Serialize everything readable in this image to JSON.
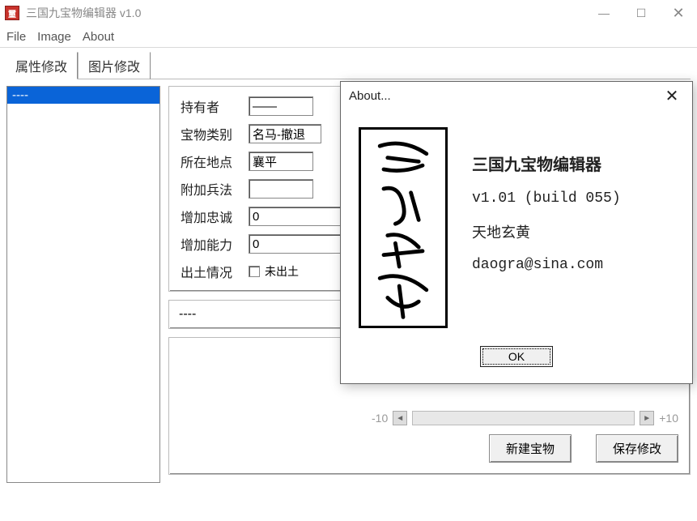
{
  "window": {
    "title": "三国九宝物编辑器 v1.0",
    "icon_char": "璽"
  },
  "menu": {
    "file": "File",
    "image": "Image",
    "about": "About"
  },
  "tabs": {
    "attr": "属性修改",
    "pic": "图片修改"
  },
  "list": {
    "item0": "----"
  },
  "form": {
    "owner_label": "持有者",
    "owner_value": "——",
    "type_label": "宝物类别",
    "type_value": "名马-撤退",
    "loc_label": "所在地点",
    "loc_value": "襄平",
    "tactic_label": "附加兵法",
    "tactic_value": "",
    "loyalty_label": "增加忠诚",
    "loyalty_value": "0",
    "ability_label": "增加能力",
    "ability_value": "0",
    "dig_label": "出土情况",
    "dig_check_label": "未出土"
  },
  "name_display": "----",
  "slider": {
    "minus": "-10",
    "plus": "+10"
  },
  "buttons": {
    "new": "新建宝物",
    "save": "保存修改"
  },
  "about": {
    "title": "About...",
    "app_name": "三国九宝物编辑器",
    "version": "v1.01  (build 055)",
    "author": "天地玄黄",
    "email": "daogra@sina.com",
    "ok": "OK"
  }
}
